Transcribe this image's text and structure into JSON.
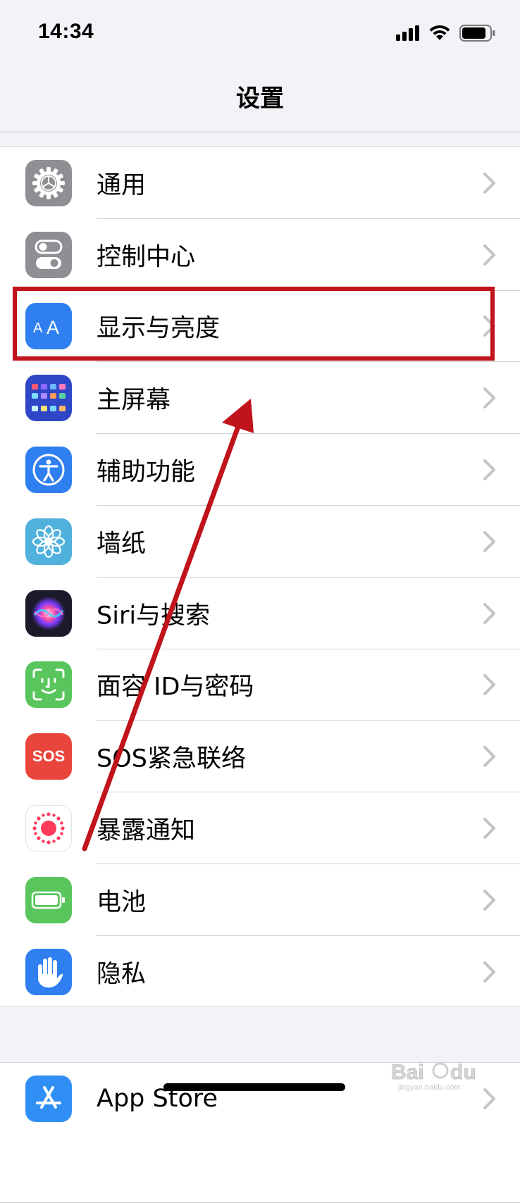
{
  "status_bar": {
    "time": "14:34"
  },
  "nav": {
    "title": "设置"
  },
  "settings": [
    {
      "label": "通用",
      "icon": "gear-icon",
      "color": "#8e8e93"
    },
    {
      "label": "控制中心",
      "icon": "toggles-icon",
      "color": "#8e8e93"
    },
    {
      "label": "显示与亮度",
      "icon": "text-size-icon",
      "color": "#2f7ff0"
    },
    {
      "label": "主屏幕",
      "icon": "home-screen-grid-icon",
      "color": "#2f47c7"
    },
    {
      "label": "辅助功能",
      "icon": "accessibility-icon",
      "color": "#2f7ff0"
    },
    {
      "label": "墙纸",
      "icon": "flower-icon",
      "color": "#4fb1dc"
    },
    {
      "label": "Siri与搜索",
      "icon": "siri-icon",
      "color": "#1a1a2a"
    },
    {
      "label": "面容 ID与密码",
      "icon": "face-id-icon",
      "color": "#58c65c"
    },
    {
      "label": "SOS紧急联络",
      "icon": "sos-icon",
      "color": "#e8453c",
      "icon_text": "SOS"
    },
    {
      "label": "暴露通知",
      "icon": "exposure-dots-icon",
      "color": "#ffffff"
    },
    {
      "label": "电池",
      "icon": "battery-icon",
      "color": "#58c65c"
    },
    {
      "label": "隐私",
      "icon": "hand-icon",
      "color": "#2f7ff0"
    }
  ],
  "settings2": [
    {
      "label": "App Store",
      "icon": "app-store-icon",
      "color": "#2f8ff5"
    }
  ],
  "annotation": {
    "highlight_color": "#c0131b"
  },
  "watermark": {
    "text": "jingyan.baidu.com"
  }
}
